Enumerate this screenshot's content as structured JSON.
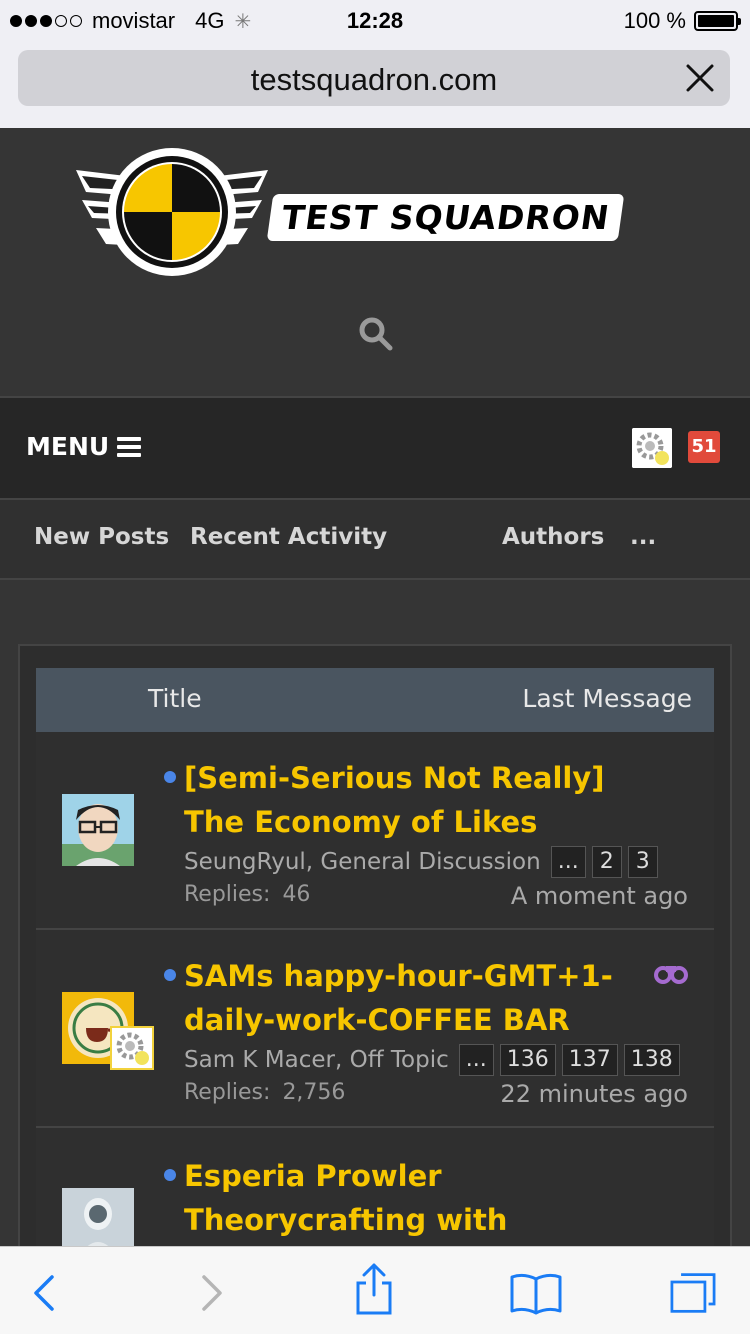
{
  "status_bar": {
    "carrier": "movistar",
    "network": "4G",
    "time": "12:28",
    "battery": "100 %"
  },
  "browser": {
    "url": "testsquadron.com"
  },
  "site": {
    "logo_text": "TEST SQUADRON",
    "accent_color": "#f7c600"
  },
  "nav": {
    "menu_label": "MENU",
    "notification_count": "51",
    "tabs": [
      "New Posts",
      "Recent Activity",
      "Authors",
      "..."
    ]
  },
  "table": {
    "header_title": "Title",
    "header_last": "Last Message",
    "threads": [
      {
        "title": "[Semi-Serious Not Really] The Economy of Likes",
        "author_forum": "SeungRyul, General Discussion",
        "pages": [
          "...",
          "2",
          "3"
        ],
        "replies_label": "Replies:",
        "replies": "46",
        "last": "A moment ago"
      },
      {
        "title": "SAMs happy-hour-GMT+1-daily-work-COFFEE BAR",
        "author_forum": "Sam K Macer, Off Topic",
        "pages": [
          "...",
          "136",
          "137",
          "138"
        ],
        "replies_label": "Replies:",
        "replies": "2,756",
        "last": "22 minutes ago"
      },
      {
        "title": "Esperia Prowler Theorycrafting with Purchase Poll!"
      }
    ]
  }
}
